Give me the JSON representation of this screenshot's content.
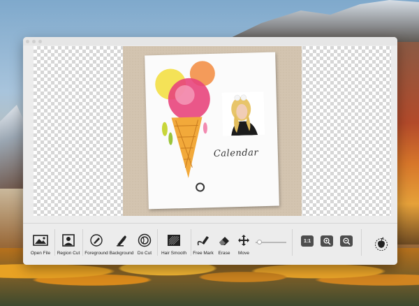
{
  "artwork": {
    "calendar_text": "Calendar"
  },
  "toolbar": {
    "open_file": "Open File",
    "region_cut": "Region Cut",
    "foreground": "Foreground",
    "background": "Background",
    "do_cut": "Do Cut",
    "hair_smooth": "Hair Smooth",
    "free_mark": "Free Mark",
    "erase": "Erase",
    "move": "Move",
    "actual_size": "1:1"
  },
  "colors": {
    "window_bg": "#ececec",
    "canvas_checker": "#d6d6d6",
    "kraft_paper": "#d3c4b0",
    "icon_dark": "#222222",
    "zoom_button": "#4d4d4d"
  },
  "icons": {
    "open_file": "image-icon",
    "region_cut": "portrait-icon",
    "foreground": "brush-icon",
    "background": "paint-brush-icon",
    "do_cut": "cut-icon",
    "hair_smooth": "hatch-icon",
    "free_mark": "marker-icon",
    "erase": "eraser-icon",
    "move": "move-icon",
    "zoom_in": "zoom-in-icon",
    "zoom_out": "zoom-out-icon",
    "apple": "apple-icon"
  }
}
